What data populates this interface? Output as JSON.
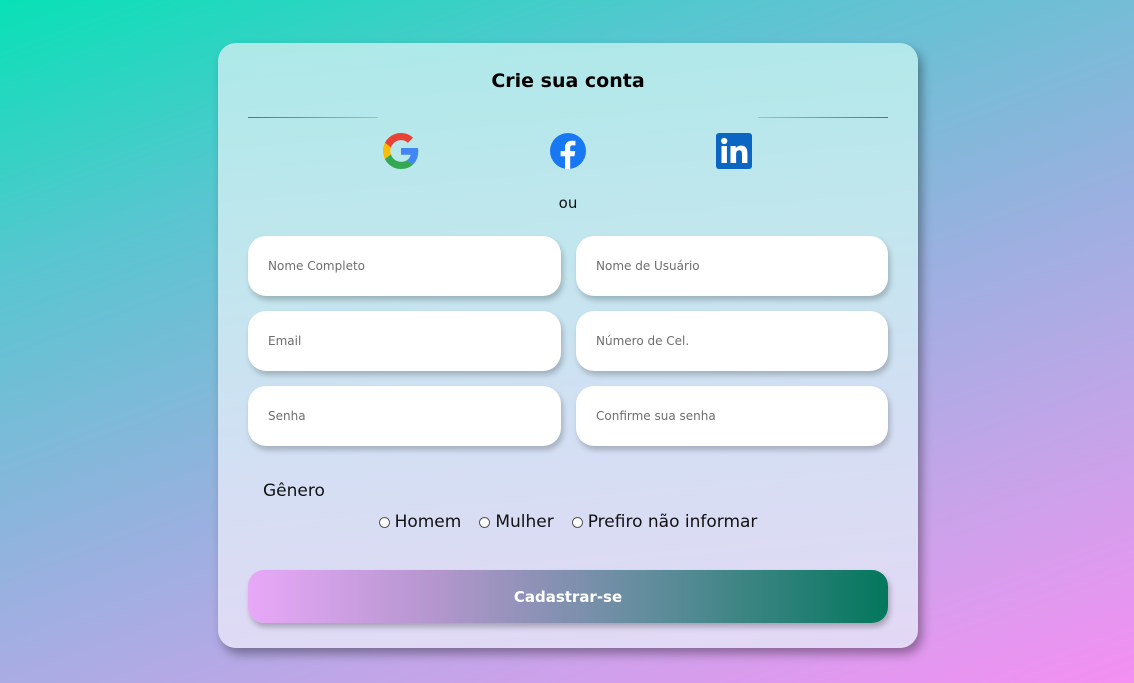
{
  "form": {
    "title": "Crie sua conta",
    "separator_text": "ou",
    "social_icons": [
      "google-icon",
      "facebook-icon",
      "linkedin-icon"
    ],
    "fields": {
      "full_name": {
        "placeholder": "Nome Completo",
        "value": ""
      },
      "username": {
        "placeholder": "Nome de Usuário",
        "value": ""
      },
      "email": {
        "placeholder": "Email",
        "value": ""
      },
      "phone": {
        "placeholder": "Número de Cel.",
        "value": ""
      },
      "password": {
        "placeholder": "Senha",
        "value": ""
      },
      "confirm_password": {
        "placeholder": "Confirme sua senha",
        "value": ""
      }
    },
    "gender": {
      "label": "Gênero",
      "options": [
        "Homem",
        "Mulher",
        "Prefiro não informar"
      ]
    },
    "submit_label": "Cadastrar-se"
  },
  "colors": {
    "facebook": "#1877f2",
    "linkedin": "#0a66c2",
    "submit_start": "#e8a8f8",
    "submit_end": "#03775c"
  }
}
